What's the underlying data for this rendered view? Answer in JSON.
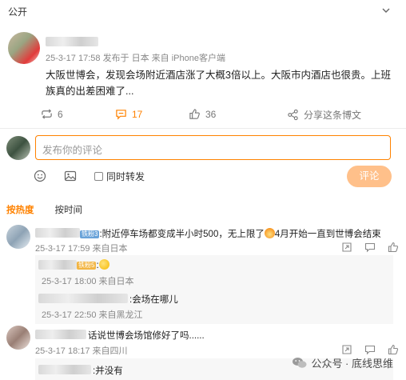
{
  "header": {
    "visibility_label": "公开"
  },
  "post": {
    "timestamp": "25-3-17 17:58",
    "meta_rest": "发布于 日本 来自 iPhone客户端",
    "body": "大阪世博会，发现会场附近酒店涨了大概3倍以上。大阪市内酒店也很贵。上班族真的出差困难了..."
  },
  "actions": {
    "repost_count": "6",
    "comment_count": "17",
    "like_count": "36",
    "share_label": "分享这条博文"
  },
  "composer": {
    "placeholder": "发布你的评论",
    "repost_label": "同时转发",
    "submit_label": "评论"
  },
  "sort_tabs": {
    "hot": "按热度",
    "time": "按时间"
  },
  "comments": [
    {
      "text": ":附近停车场都变成半小时500，无上限了",
      "text_after": "4月开始一直到世博会结束",
      "badge": "铁粉3",
      "meta": "25-3-17 17:59 来自日本",
      "replies": [
        {
          "badge": "铁粉5",
          "text": ":",
          "meta": "25-3-17 18:00 来自日本"
        },
        {
          "text": ":会场在哪儿",
          "meta": "25-3-17 22:50 来自黑龙江"
        }
      ]
    },
    {
      "text": "话说世博会场馆修好了吗......",
      "meta": "25-3-17 18:17 来自四川",
      "replies": [
        {
          "text": ":并没有"
        }
      ]
    }
  ],
  "watermark": {
    "text": "公众号 · 底线思维"
  },
  "colors": {
    "accent": "#ff8200",
    "submit_bg": "#ffc08a",
    "muted": "#888888"
  },
  "icons": [
    "chevron-down-icon",
    "repost-icon",
    "comment-icon",
    "like-icon",
    "share-icon",
    "emoji-icon",
    "image-icon",
    "wechat-icon"
  ]
}
